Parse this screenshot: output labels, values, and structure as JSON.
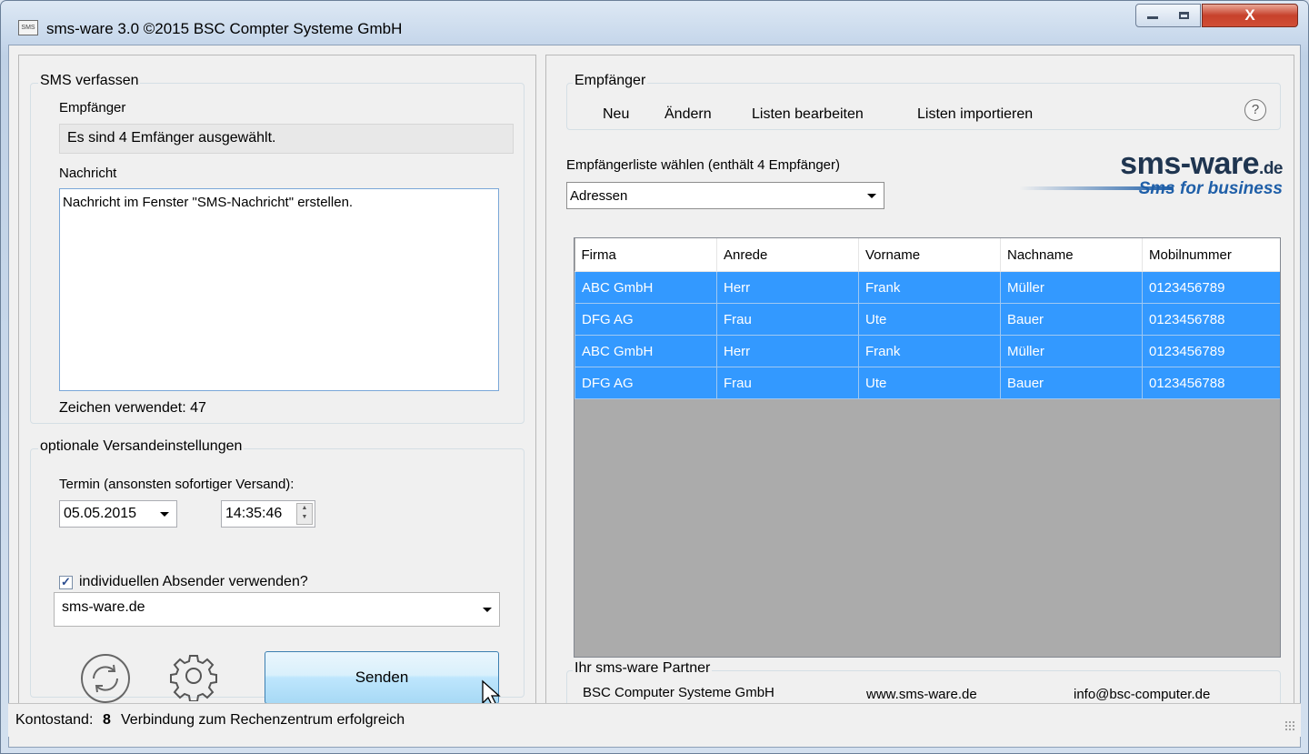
{
  "window": {
    "title": "sms-ware 3.0 ©2015 BSC Compter Systeme GmbH",
    "app_icon_text": "SMS",
    "close_glyph": "X"
  },
  "compose": {
    "legend": "SMS verfassen",
    "recipients_label": "Empfänger",
    "recipients_value": "Es sind 4 Emfänger ausgewählt.",
    "message_label": "Nachricht",
    "message_value": "Nachricht im Fenster \"SMS-Nachricht\" erstellen.",
    "chars_used": "Zeichen verwendet: 47"
  },
  "options": {
    "legend": "optionale Versandeinstellungen",
    "schedule_label": "Termin (ansonsten sofortiger Versand):",
    "date": "05.05.2015",
    "time": "14:35:46",
    "sender_checkbox_label": "individuellen Absender verwenden?",
    "sender_checked": true,
    "checkmark": "✓",
    "sender_value": "sms-ware.de",
    "send_button": "Senden",
    "refresh_icon": "refresh-icon",
    "settings_icon": "gear-icon"
  },
  "recipients": {
    "legend": "Empfänger",
    "menu": [
      "Neu",
      "Ändern",
      "Listen bearbeiten",
      "Listen importieren"
    ],
    "help": "?",
    "list_label": "Empfängerliste wählen (enthält 4 Empfänger)",
    "list_selected": "Adressen",
    "logo_main": "sms-ware",
    "logo_tld": ".de",
    "logo_tagline": "Sms for business",
    "brand_color": "#1f5fa8"
  },
  "table": {
    "columns": [
      "Firma",
      "Anrede",
      "Vorname",
      "Nachname",
      "Mobilnummer"
    ],
    "rows": [
      [
        "ABC GmbH",
        "Herr",
        "Frank",
        "Müller",
        "0123456789"
      ],
      [
        "DFG AG",
        "Frau",
        "Ute",
        "Bauer",
        "0123456788"
      ],
      [
        "ABC GmbH",
        "Herr",
        "Frank",
        "Müller",
        "0123456789"
      ],
      [
        "DFG AG",
        "Frau",
        "Ute",
        "Bauer",
        "0123456788"
      ]
    ],
    "selection_color": "#3399ff"
  },
  "partner": {
    "legend": "Ihr sms-ware Partner",
    "company": "BSC Computer Systeme GmbH",
    "website": "www.sms-ware.de",
    "email": "info@bsc-computer.de"
  },
  "status": {
    "balance_label": "Kontostand:",
    "balance_value": "8",
    "message": "Verbindung zum Rechenzentrum erfolgreich"
  }
}
